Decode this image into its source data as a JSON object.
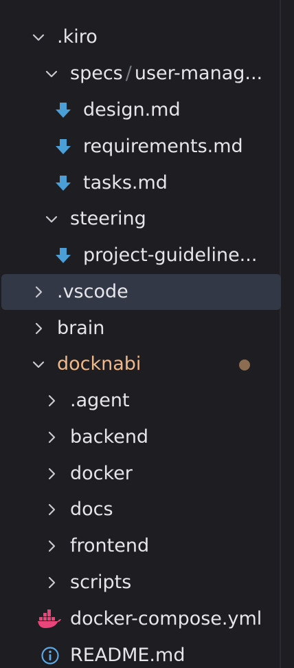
{
  "colors": {
    "background": "#1e1d22",
    "text": "#e6e6ea",
    "selected_row": "#323846",
    "modified_folder": "#f0b98a",
    "modified_dot": "#8c6d52",
    "markdown_icon": "#4a9fd6",
    "docker_icon": "#e8457a",
    "info_icon": "#5aa9e6"
  },
  "tree": {
    "kiro": {
      "label": ".kiro"
    },
    "specs": {
      "label_a": "specs",
      "separator": "/",
      "label_b": "user-manag..."
    },
    "design": {
      "label": "design.md",
      "icon": "markdown-arrow-icon"
    },
    "requirements": {
      "label": "requirements.md",
      "icon": "markdown-arrow-icon"
    },
    "tasks": {
      "label": "tasks.md",
      "icon": "markdown-arrow-icon"
    },
    "steering": {
      "label": "steering"
    },
    "project_guidelines": {
      "label": "project-guideline...",
      "icon": "markdown-arrow-icon"
    },
    "vscode": {
      "label": ".vscode"
    },
    "brain": {
      "label": "brain"
    },
    "docknabi": {
      "label": "docknabi",
      "status": "modified-dot"
    },
    "agent": {
      "label": ".agent"
    },
    "backend": {
      "label": "backend"
    },
    "docker": {
      "label": "docker"
    },
    "docs": {
      "label": "docs"
    },
    "frontend": {
      "label": "frontend"
    },
    "scripts": {
      "label": "scripts"
    },
    "docker_compose": {
      "label": "docker-compose.yml",
      "icon": "docker-whale-icon"
    },
    "readme": {
      "label": "README.md",
      "icon": "info-icon"
    }
  }
}
